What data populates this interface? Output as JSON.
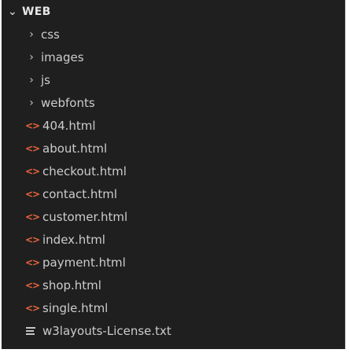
{
  "explorer": {
    "root": {
      "label": "WEB",
      "chevron": "chevron-down-icon"
    },
    "folders": [
      {
        "label": "css"
      },
      {
        "label": "images"
      },
      {
        "label": "js"
      },
      {
        "label": "webfonts"
      }
    ],
    "files": [
      {
        "label": "404.html"
      },
      {
        "label": "about.html"
      },
      {
        "label": "checkout.html"
      },
      {
        "label": "contact.html"
      },
      {
        "label": "customer.html"
      },
      {
        "label": "index.html"
      },
      {
        "label": "payment.html"
      },
      {
        "label": "shop.html"
      },
      {
        "label": "single.html"
      }
    ],
    "text_file": {
      "label": "w3layouts-License.txt"
    }
  },
  "colors": {
    "background": "#1f1f1f",
    "text": "#cccccc",
    "html_icon": "#e8643c"
  }
}
